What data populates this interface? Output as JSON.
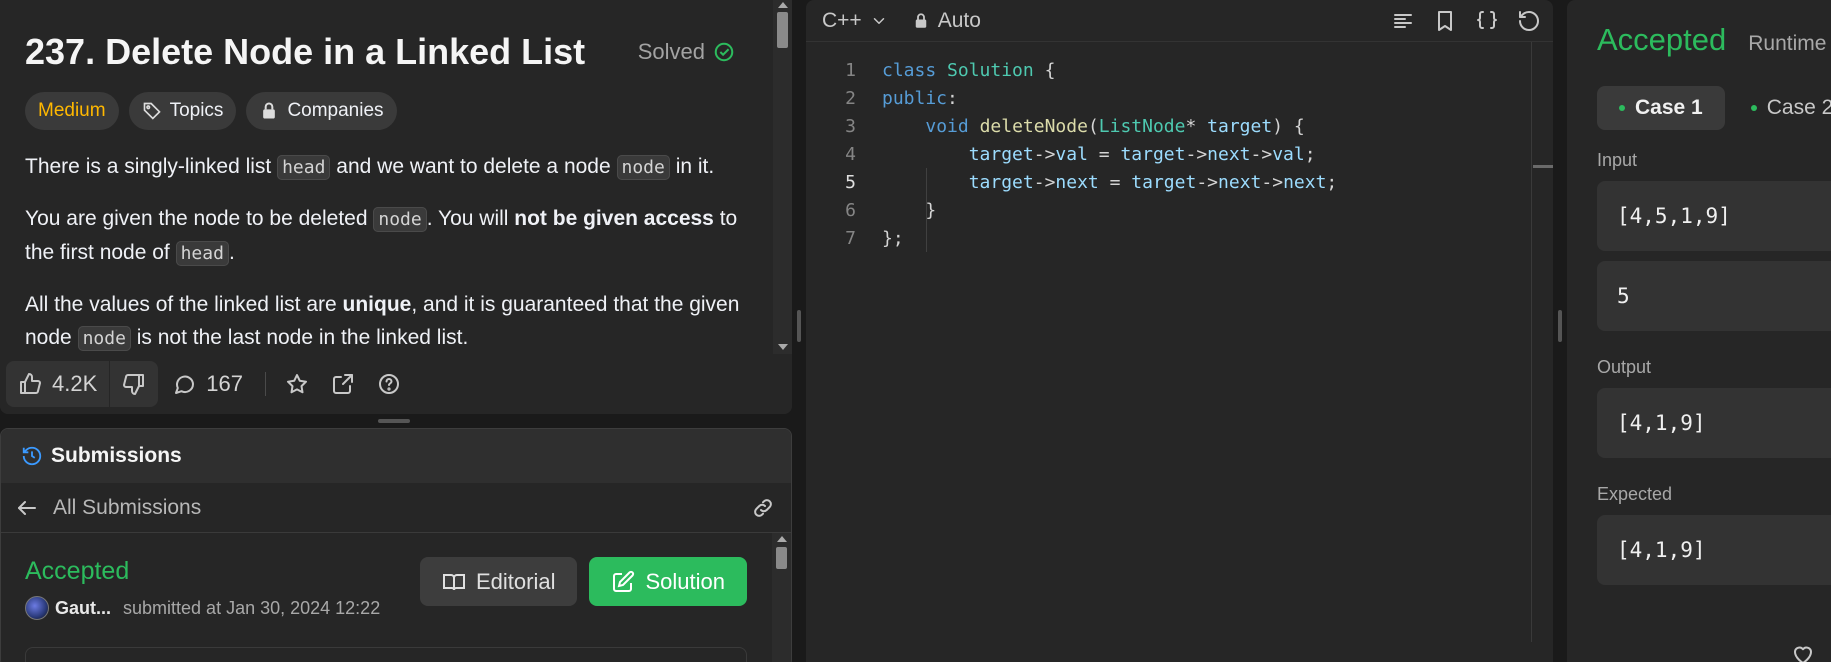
{
  "description": {
    "title": "237. Delete Node in a Linked List",
    "status": "Solved",
    "tags": [
      "Medium",
      "Topics",
      "Companies"
    ],
    "p1": {
      "a": "There is a singly-linked list ",
      "code1": "head",
      "b": " and we want to delete a node ",
      "code2": "node",
      "c": " in it."
    },
    "p2": {
      "a": "You are given the node to be deleted ",
      "code1": "node",
      "b": ". You will ",
      "bold": "not be given access",
      "c": " to the first node of ",
      "code2": "head",
      "d": "."
    },
    "p3": {
      "a": "All the values of the linked list are ",
      "bold": "unique",
      "b": ", and it is guaranteed that the given node ",
      "code1": "node",
      "c": " is not the last node in the linked list."
    }
  },
  "actions": {
    "likes": "4.2K",
    "comments": "167"
  },
  "submissions": {
    "header": "Submissions",
    "nav_label": "All Submissions",
    "status": "Accepted",
    "user": "Gaut...",
    "submitted_text": "submitted at Jan 30, 2024 12:22",
    "editorial_label": "Editorial",
    "solution_label": "Solution"
  },
  "editor": {
    "language": "C++",
    "mode": "Auto",
    "line_numbers": [
      "1",
      "2",
      "3",
      "4",
      "5",
      "6",
      "7"
    ]
  },
  "result": {
    "status": "Accepted",
    "runtime_label": "Runtime",
    "cases": [
      "Case 1",
      "Case 2"
    ],
    "input_label": "Input",
    "input_values": [
      "[4,5,1,9]",
      "5"
    ],
    "output_label": "Output",
    "output_value": "[4,1,9]",
    "expected_label": "Expected",
    "expected_value": "[4,1,9]"
  },
  "colors": {
    "accepted_green": "#2cbb5d",
    "medium_yellow": "#ffb800",
    "panel_bg": "#262626",
    "app_bg": "#1a1a1a"
  }
}
